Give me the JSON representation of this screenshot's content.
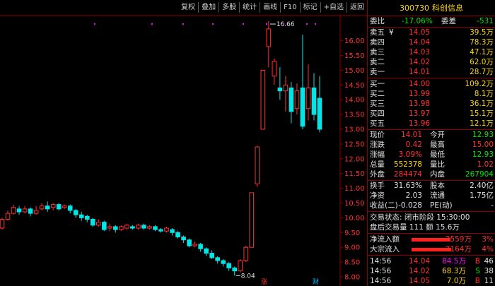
{
  "toolbar": [
    "复权",
    "叠加",
    "多股",
    "统计",
    "画线",
    "F10",
    "标记",
    "+自选",
    "返回"
  ],
  "stock": {
    "code": "300730",
    "name": "科创信息"
  },
  "chart_data": {
    "type": "candlestick",
    "ylim": [
      8.0,
      16.9
    ],
    "yticks": [
      "16.00",
      "15.50",
      "15.00",
      "14.50",
      "14.00",
      "13.50",
      "13.00",
      "12.50",
      "12.00",
      "11.50",
      "11.00",
      "10.50",
      "10.00",
      "9.50",
      "9.00",
      "8.50",
      "8.00"
    ],
    "high_label": "16.66",
    "low_label": "8.04",
    "bottom_markers": [
      "涨",
      "财"
    ],
    "candles": [
      [
        9.65,
        9.95,
        9.6,
        10.0
      ],
      [
        9.95,
        10.15,
        9.9,
        10.25
      ],
      [
        10.15,
        10.35,
        10.1,
        10.45
      ],
      [
        10.3,
        10.2,
        10.1,
        10.4
      ],
      [
        10.2,
        10.3,
        10.15,
        10.4
      ],
      [
        10.3,
        10.15,
        10.05,
        10.35
      ],
      [
        10.15,
        10.25,
        10.1,
        10.4
      ],
      [
        10.3,
        10.4,
        10.25,
        10.5
      ],
      [
        10.4,
        10.3,
        10.2,
        10.55
      ],
      [
        10.35,
        10.45,
        10.25,
        10.5
      ],
      [
        10.45,
        10.3,
        10.25,
        10.5
      ],
      [
        10.35,
        10.4,
        10.3,
        10.45
      ],
      [
        10.4,
        10.25,
        10.15,
        10.45
      ],
      [
        10.25,
        10.1,
        10.0,
        10.3
      ],
      [
        10.1,
        10.0,
        9.9,
        10.2
      ],
      [
        10.05,
        9.95,
        9.85,
        10.1
      ],
      [
        9.95,
        9.75,
        9.7,
        10.0
      ],
      [
        9.75,
        9.85,
        9.7,
        9.95
      ],
      [
        9.85,
        9.6,
        9.55,
        9.9
      ],
      [
        9.65,
        9.7,
        9.55,
        9.8
      ],
      [
        9.7,
        9.6,
        9.5,
        9.75
      ],
      [
        9.6,
        9.7,
        9.55,
        9.75
      ],
      [
        9.65,
        9.75,
        9.6,
        9.8
      ],
      [
        9.7,
        9.65,
        9.6,
        9.75
      ],
      [
        9.65,
        9.75,
        9.6,
        9.8
      ],
      [
        9.75,
        9.65,
        9.6,
        9.8
      ],
      [
        9.65,
        9.7,
        9.6,
        9.75
      ],
      [
        9.7,
        9.6,
        9.55,
        9.75
      ],
      [
        9.6,
        9.55,
        9.5,
        9.65
      ],
      [
        9.55,
        9.65,
        9.5,
        9.7
      ],
      [
        9.6,
        9.5,
        9.4,
        9.65
      ],
      [
        9.5,
        9.35,
        9.3,
        9.55
      ],
      [
        9.35,
        9.25,
        9.15,
        9.4
      ],
      [
        9.25,
        9.05,
        9.0,
        9.3
      ],
      [
        9.05,
        9.1,
        9.0,
        9.2
      ],
      [
        9.1,
        8.95,
        8.85,
        9.15
      ],
      [
        8.95,
        8.8,
        8.7,
        9.0
      ],
      [
        8.8,
        8.65,
        8.6,
        8.9
      ],
      [
        8.65,
        8.55,
        8.45,
        8.7
      ],
      [
        8.55,
        8.45,
        8.35,
        8.6
      ],
      [
        8.45,
        8.3,
        8.2,
        8.5
      ],
      [
        8.3,
        8.2,
        8.04,
        8.35
      ],
      [
        8.2,
        8.55,
        8.15,
        8.6
      ],
      [
        8.55,
        9.0,
        8.5,
        9.05
      ],
      [
        9.0,
        10.85,
        9.0,
        10.85
      ],
      [
        11.15,
        12.4,
        11.05,
        12.45
      ],
      [
        13.0,
        15.0,
        13.0,
        15.0
      ],
      [
        15.8,
        16.4,
        15.1,
        16.66
      ],
      [
        14.8,
        15.3,
        14.5,
        15.4
      ],
      [
        14.4,
        14.3,
        14.0,
        15.1
      ],
      [
        14.3,
        14.5,
        13.6,
        14.8
      ],
      [
        14.4,
        13.6,
        13.2,
        14.6
      ],
      [
        13.7,
        14.3,
        13.5,
        14.55
      ],
      [
        14.4,
        13.1,
        13.0,
        16.2
      ],
      [
        13.7,
        14.4,
        13.3,
        15.2
      ],
      [
        14.4,
        13.5,
        13.3,
        14.9
      ],
      [
        14.05,
        13.0,
        12.9,
        14.8
      ]
    ]
  },
  "quote": {
    "weibi_label": "委比",
    "weibi": "-17.06%",
    "weicha_label": "委差",
    "weicha": "-531",
    "sells": [
      {
        "label": "卖五",
        "mark": "¥",
        "price": "14.05",
        "vol": "39.5万"
      },
      {
        "label": "卖四",
        "price": "14.04",
        "vol": "78.3万"
      },
      {
        "label": "卖三",
        "price": "14.03",
        "vol": "47.1万"
      },
      {
        "label": "卖二",
        "price": "14.02",
        "vol": "62.0万"
      },
      {
        "label": "卖一",
        "price": "14.01",
        "vol": "28.7万"
      }
    ],
    "buys": [
      {
        "label": "买一",
        "price": "14.00",
        "vol": "109.2万"
      },
      {
        "label": "买二",
        "price": "13.99",
        "vol": "8.1万"
      },
      {
        "label": "买三",
        "price": "13.98",
        "vol": "36.1万"
      },
      {
        "label": "买四",
        "price": "13.97",
        "vol": "15.1万"
      },
      {
        "label": "买五",
        "price": "13.96",
        "vol": "12.1万"
      }
    ],
    "stats": [
      {
        "l1": "现价",
        "v1": "14.01",
        "l2": "今开",
        "v2": "12.93"
      },
      {
        "l1": "涨跌",
        "v1": "0.42",
        "l2": "最高",
        "v2": "15.00"
      },
      {
        "l1": "涨幅",
        "v1": "3.09%",
        "l2": "最低",
        "v2": "12.93"
      },
      {
        "l1": "总量",
        "v1": "552378",
        "l2": "量比",
        "v2": "1.02"
      },
      {
        "l1": "外盘",
        "v1": "284474",
        "l2": "内盘",
        "v2": "267904"
      }
    ],
    "fin": [
      {
        "l1": "换手",
        "v1": "31.63%",
        "l2": "股本",
        "v2": "2.40亿"
      },
      {
        "l1": "净资",
        "v1": "2.03",
        "l2": "流通",
        "v2": "1.75亿"
      },
      {
        "l1": "收益(二)",
        "v1": "-0.028",
        "l2": "PE(动)",
        "v2": "-"
      }
    ],
    "status": "交易状态: 闭市阶段 15:30:00",
    "after": "盘后交易量 111 额 15.6万",
    "flows": [
      {
        "label": "净流入额",
        "value": "2559万",
        "pct": "3%",
        "fill": 0.25
      },
      {
        "label": "大宗流入",
        "value": "3164万",
        "pct": "4%",
        "fill": 0.35
      }
    ],
    "trades": [
      {
        "time": "14:56",
        "price": "14.04",
        "vol": "84.5万",
        "side": "B",
        "n": "46"
      },
      {
        "time": "14:56",
        "price": "14.02",
        "vol": "68.3万",
        "side": "S",
        "n": "38"
      },
      {
        "time": "14:56",
        "price": "14.05",
        "vol": "7.0万",
        "side": "B",
        "n": "11"
      }
    ]
  }
}
